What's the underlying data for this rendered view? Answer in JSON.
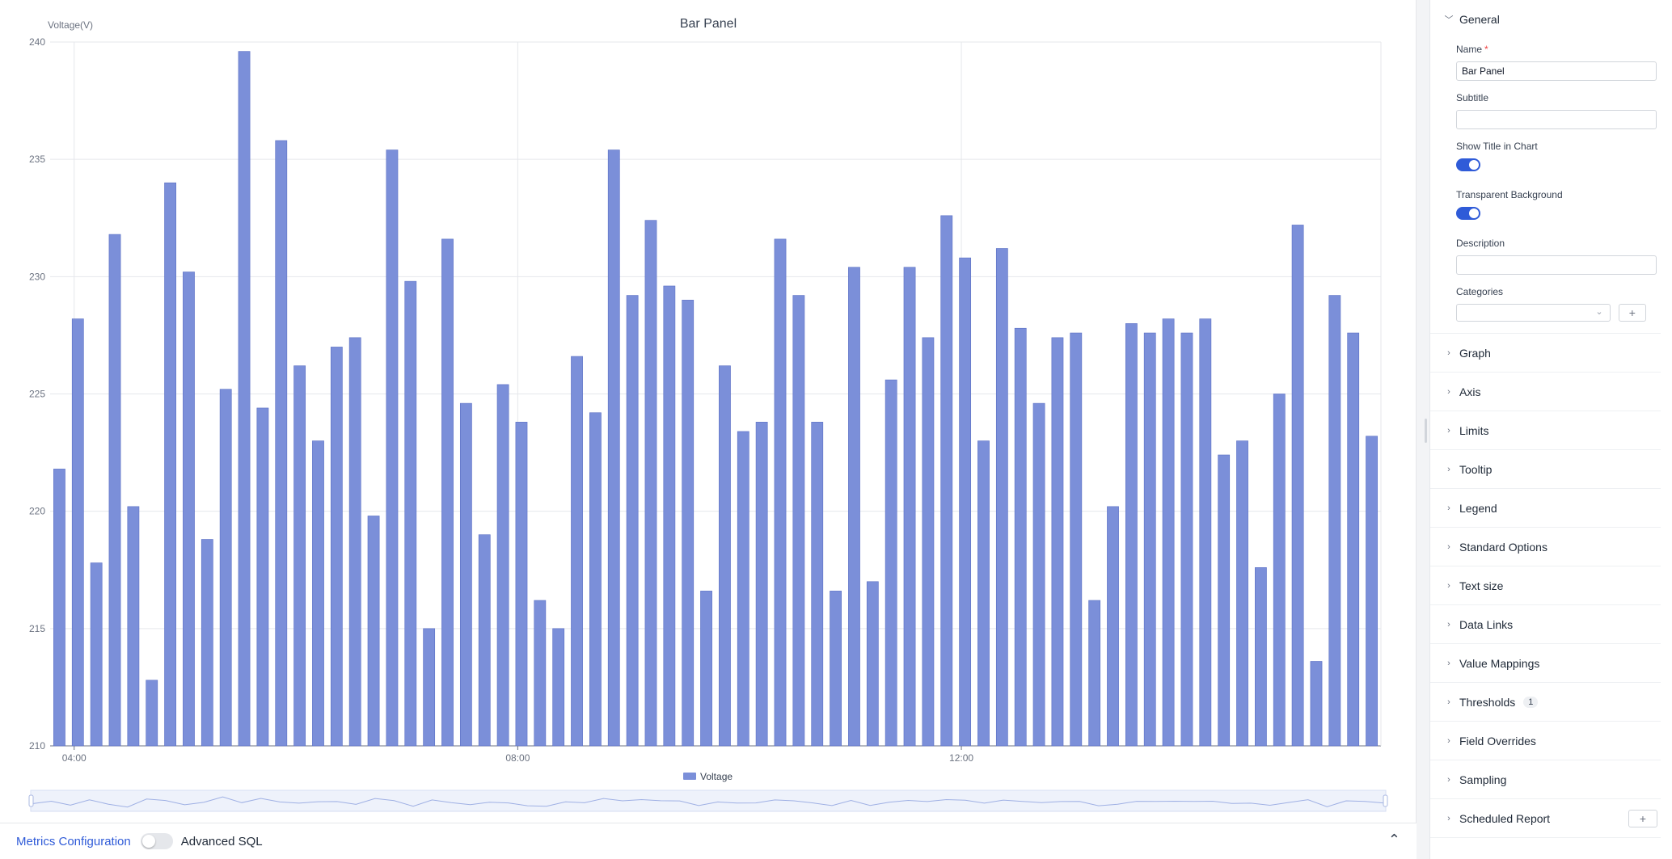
{
  "chart_data": {
    "type": "bar",
    "title": "Bar Panel",
    "ylabel": "Voltage(V)",
    "ylim": [
      210,
      240
    ],
    "y_ticks": [
      210,
      215,
      220,
      225,
      230,
      235,
      240
    ],
    "x_ticks": [
      "04:00",
      "08:00",
      "12:00"
    ],
    "x_tick_indices": [
      1.3,
      25.3,
      49.3
    ],
    "series": [
      {
        "name": "Voltage",
        "color": "#7b8fd9",
        "values": [
          221.8,
          228.2,
          217.8,
          231.8,
          220.2,
          212.8,
          234.0,
          230.2,
          218.8,
          225.2,
          239.6,
          224.4,
          235.8,
          226.2,
          223.0,
          227.0,
          227.4,
          219.8,
          235.4,
          229.8,
          215.0,
          231.6,
          224.6,
          219.0,
          225.4,
          223.8,
          216.2,
          215.0,
          226.6,
          224.2,
          235.4,
          229.2,
          232.4,
          229.6,
          229.0,
          216.6,
          226.2,
          223.4,
          223.8,
          231.6,
          229.2,
          223.8,
          216.6,
          230.4,
          217.0,
          225.6,
          230.4,
          227.4,
          232.6,
          230.8,
          223.0,
          231.2,
          227.8,
          224.6,
          227.4,
          227.6,
          216.2,
          220.2,
          228.0,
          227.6,
          228.2,
          227.6,
          228.2,
          222.4,
          223.0,
          217.6,
          225.0,
          232.2,
          213.6,
          229.2,
          227.6,
          223.2
        ]
      }
    ],
    "legend": "bottom-center",
    "grid": true
  },
  "bottom_bar": {
    "metrics_label": "Metrics Configuration",
    "advanced_label": "Advanced SQL"
  },
  "panel": {
    "general": {
      "title": "General",
      "name_label": "Name",
      "name_required": "*",
      "name_value": "Bar Panel",
      "subtitle_label": "Subtitle",
      "subtitle_value": "",
      "show_title_label": "Show Title in Chart",
      "transparent_label": "Transparent Background",
      "description_label": "Description",
      "description_value": "",
      "categories_label": "Categories",
      "add_label": "+"
    },
    "sections": [
      "Graph",
      "Axis",
      "Limits",
      "Tooltip",
      "Legend",
      "Standard Options",
      "Text size",
      "Data Links",
      "Value Mappings",
      "Thresholds",
      "Field Overrides",
      "Sampling",
      "Scheduled Report"
    ],
    "thresholds_badge": "1"
  }
}
